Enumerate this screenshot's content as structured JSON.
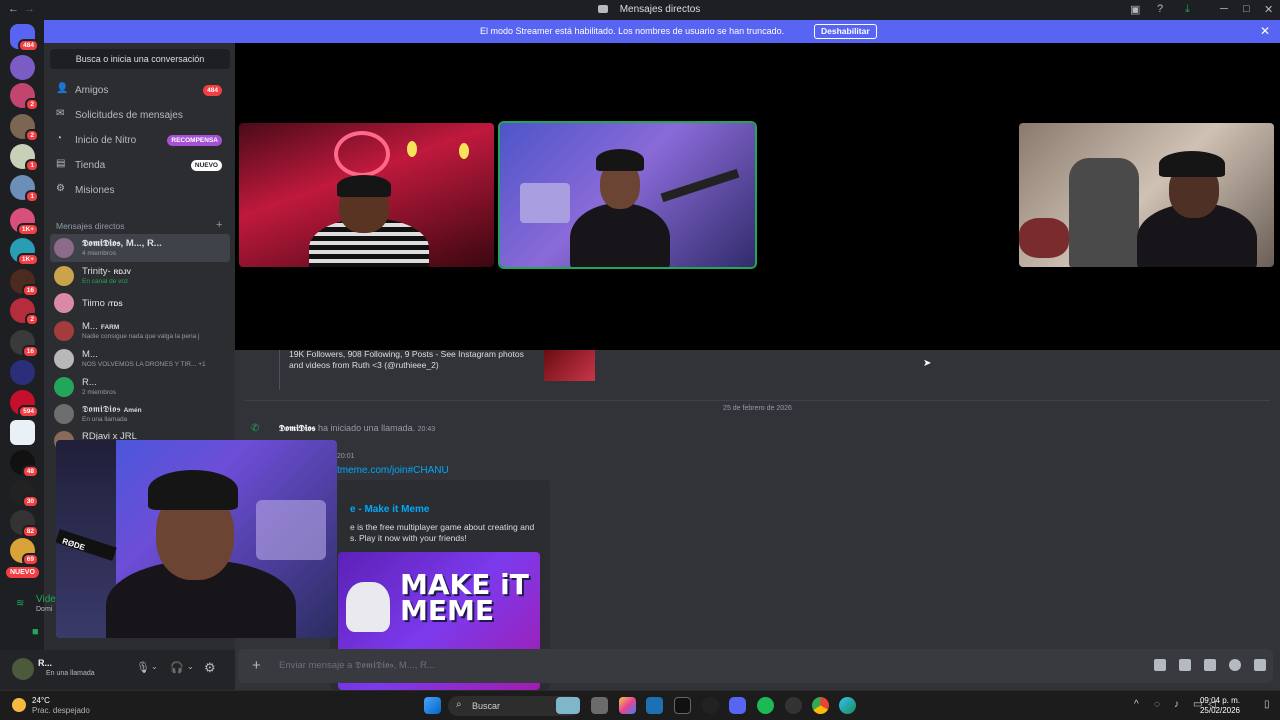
{
  "window": {
    "title": "Mensajes directos"
  },
  "banner": {
    "message": "El modo Streamer está habilitado. Los nombres de usuario se han truncado.",
    "button": "Deshabilitar"
  },
  "rail": {
    "badges": [
      "484",
      "2",
      "2",
      "1",
      "1",
      "1K+",
      "1K+",
      "16",
      "2",
      "16",
      "594",
      "48",
      "30",
      "82",
      "69"
    ],
    "nuevo": "NUEVO"
  },
  "sidebar": {
    "search": "Busca o inicia una conversación",
    "nav": [
      {
        "label": "Amigos",
        "badge": "484",
        "icon": "friends-icon"
      },
      {
        "label": "Solicitudes de mensajes",
        "badge": "",
        "icon": "mail-icon"
      },
      {
        "label": "Inicio de Nitro",
        "badge": "RECOMPENSA",
        "icon": "nitro-icon"
      },
      {
        "label": "Tienda",
        "badge": "NUEVO",
        "icon": "shop-icon"
      },
      {
        "label": "Misiones",
        "badge": "",
        "icon": "quest-icon"
      }
    ],
    "dm_header": "Mensajes directos",
    "dms": [
      {
        "name": "𝕯𝖔𝖒𝖎𝕯𝖎𝖔𝖘, M..., R...",
        "sub": "4 miembros"
      },
      {
        "name": "Trinity-",
        "tag": "RDJV",
        "sub": "En canal de voz"
      },
      {
        "name": "Tiimo",
        "tag": "/TDS",
        "sub": ""
      },
      {
        "name": "M...",
        "tag": "FARM",
        "sub": "Nadie consigue nada que valga la pena j"
      },
      {
        "name": "M...",
        "tag": "",
        "sub": "NOS VOLVEMOS LA DRONES Y TIR...  +1"
      },
      {
        "name": "R...",
        "tag": "",
        "sub": "2 miembros"
      },
      {
        "name": "𝕯𝖔𝖒𝖎𝕯𝖎𝖔𝖘",
        "tag": "Amén",
        "sub": "En una llamada"
      },
      {
        "name": "RDjavi x JRL",
        "tag": "",
        "sub": ""
      }
    ]
  },
  "voice": {
    "status": "Vide",
    "channel": "Domi"
  },
  "user": {
    "name": "R...",
    "status": "En una llamada"
  },
  "chat": {
    "embed_text": "19K Followers, 908 Following, 9 Posts - See Instagram photos and videos from Ruth <3 (@ruthieee_2)",
    "date": "25 de febrero de 2026",
    "call_user": "𝕯𝖔𝖒𝖎𝕯𝖎𝖔𝖘",
    "call_text": "ha iniciado una llamada.",
    "call_time": "20:43",
    "partial_time": "20:01",
    "link": "tmeme.com/join#CHANU",
    "embed_title": "e - Make it Meme",
    "embed_desc": "e is the free multiplayer game about creating and s. Play it now with your friends!",
    "embed_logo": "MAKE iT MEME",
    "placeholder": "Enviar mensaje a 𝕯𝖔𝖒𝖎𝕯𝖎𝖔𝖘, M..., R..."
  },
  "taskbar": {
    "temp": "24°C",
    "weather": "Prac. despejado",
    "search": "Buscar",
    "time": "09:04 p. m.",
    "date": "25/02/2026"
  },
  "colors": {
    "accent": "#5865f2",
    "danger": "#f23f43",
    "online": "#23a55a",
    "link": "#00a8fc"
  }
}
